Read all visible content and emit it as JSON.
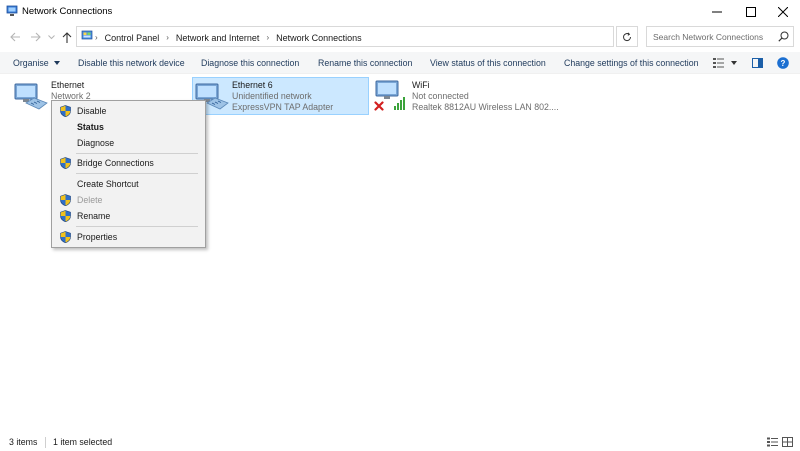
{
  "window": {
    "title": "Network Connections",
    "icons": {
      "app": "network-connections-icon",
      "minimize": "minimize-icon",
      "maximize": "maximize-icon",
      "close": "close-icon"
    }
  },
  "addressbar": {
    "breadcrumbs": [
      "Control Panel",
      "Network and Internet",
      "Network Connections"
    ],
    "search_placeholder": "Search Network Connections"
  },
  "commandbar": {
    "organise": "Organise",
    "disable": "Disable this network device",
    "diagnose": "Diagnose this connection",
    "rename": "Rename this connection",
    "view_status": "View status of this connection",
    "change_settings": "Change settings of this connection"
  },
  "connections": [
    {
      "name": "Ethernet",
      "status": "Network 2",
      "adapter": ""
    },
    {
      "name": "Ethernet 6",
      "status": "Unidentified network",
      "adapter": "ExpressVPN TAP Adapter"
    },
    {
      "name": "WiFi",
      "status": "Not connected",
      "adapter": "Realtek 8812AU Wireless LAN 802...."
    }
  ],
  "context_menu": {
    "disable": "Disable",
    "status": "Status",
    "diagnose": "Diagnose",
    "bridge": "Bridge Connections",
    "create_shortcut": "Create Shortcut",
    "delete": "Delete",
    "rename": "Rename",
    "properties": "Properties"
  },
  "statusbar": {
    "item_count": "3 items",
    "selected": "1 item selected"
  },
  "colors": {
    "selection_bg": "#cce8ff",
    "selection_border": "#99d1ff",
    "command_text": "#1e395b",
    "shield_blue": "#2f6fc9",
    "shield_yellow": "#f2c21b"
  }
}
